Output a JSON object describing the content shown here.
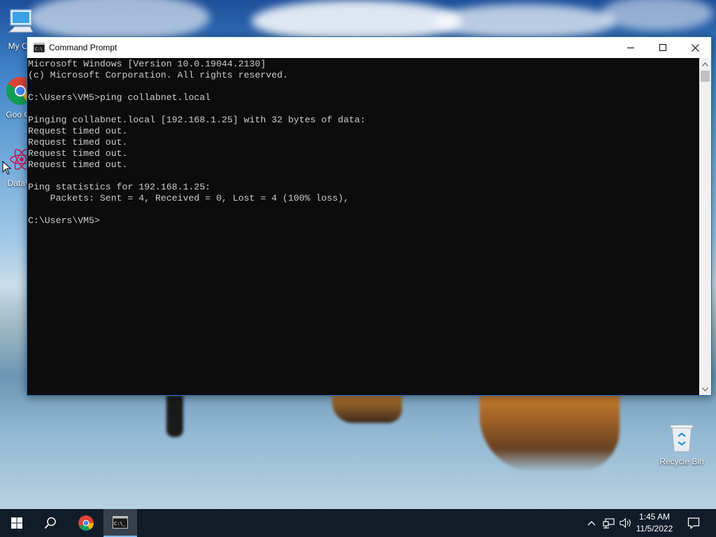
{
  "desktop": {
    "icons": [
      {
        "label": "My Co",
        "icon": "computer-icon"
      },
      {
        "label": "Goo Ch",
        "icon": "chrome-icon"
      },
      {
        "label": "DataW",
        "icon": "datawrapper-app-icon"
      },
      {
        "label": "Recycle Bin",
        "icon": "recycle-bin-icon"
      }
    ]
  },
  "window": {
    "title": "Command Prompt",
    "app_icon": "cmd-icon",
    "controls": {
      "minimize": "minimize-icon",
      "maximize": "maximize-icon",
      "close": "close-icon"
    }
  },
  "console": {
    "lines": [
      "Microsoft Windows [Version 10.0.19044.2130]",
      "(c) Microsoft Corporation. All rights reserved.",
      "",
      "C:\\Users\\VM5>ping collabnet.local",
      "",
      "Pinging collabnet.local [192.168.1.25] with 32 bytes of data:",
      "Request timed out.",
      "Request timed out.",
      "Request timed out.",
      "Request timed out.",
      "",
      "Ping statistics for 192.168.1.25:",
      "    Packets: Sent = 4, Received = 0, Lost = 4 (100% loss),",
      "",
      "C:\\Users\\VM5>"
    ]
  },
  "taskbar": {
    "items": [
      "start-windows-icon",
      "search-icon",
      "chrome-icon",
      "cmd-icon"
    ],
    "tray_icons": [
      "chevron-up-icon",
      "network-icon",
      "volume-icon"
    ],
    "clock": {
      "time": "1:45 AM",
      "date": "11/5/2022"
    },
    "notification_icon": "action-center-icon"
  },
  "colors": {
    "console_bg": "#0c0c0c",
    "console_text": "#cccccc",
    "taskbar_bg": "#101c28",
    "window_border": "#1f6fc0"
  }
}
